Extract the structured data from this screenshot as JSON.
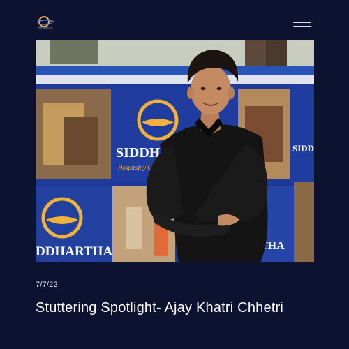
{
  "header": {
    "logo_icon": "stutter-community-logo",
    "logo_text": "MySpeech",
    "menu_icon": "hamburger-menu-icon"
  },
  "post": {
    "date": "7/7/22",
    "title": "Stuttering Spotlight- Ajay Khatri Chhetri",
    "image_sign_text_top": "SIDDHARTHA",
    "image_sign_subtext": "Hospitality Group",
    "image_sign_text_bottom": "DDHARTHA",
    "image_sign_text_right": "SIDD",
    "image_sign_text_right_bottom": "THA"
  },
  "colors": {
    "background": "#0c1230",
    "sign_blue": "#1d3a9a",
    "logo_gold": "#f0b23a"
  }
}
